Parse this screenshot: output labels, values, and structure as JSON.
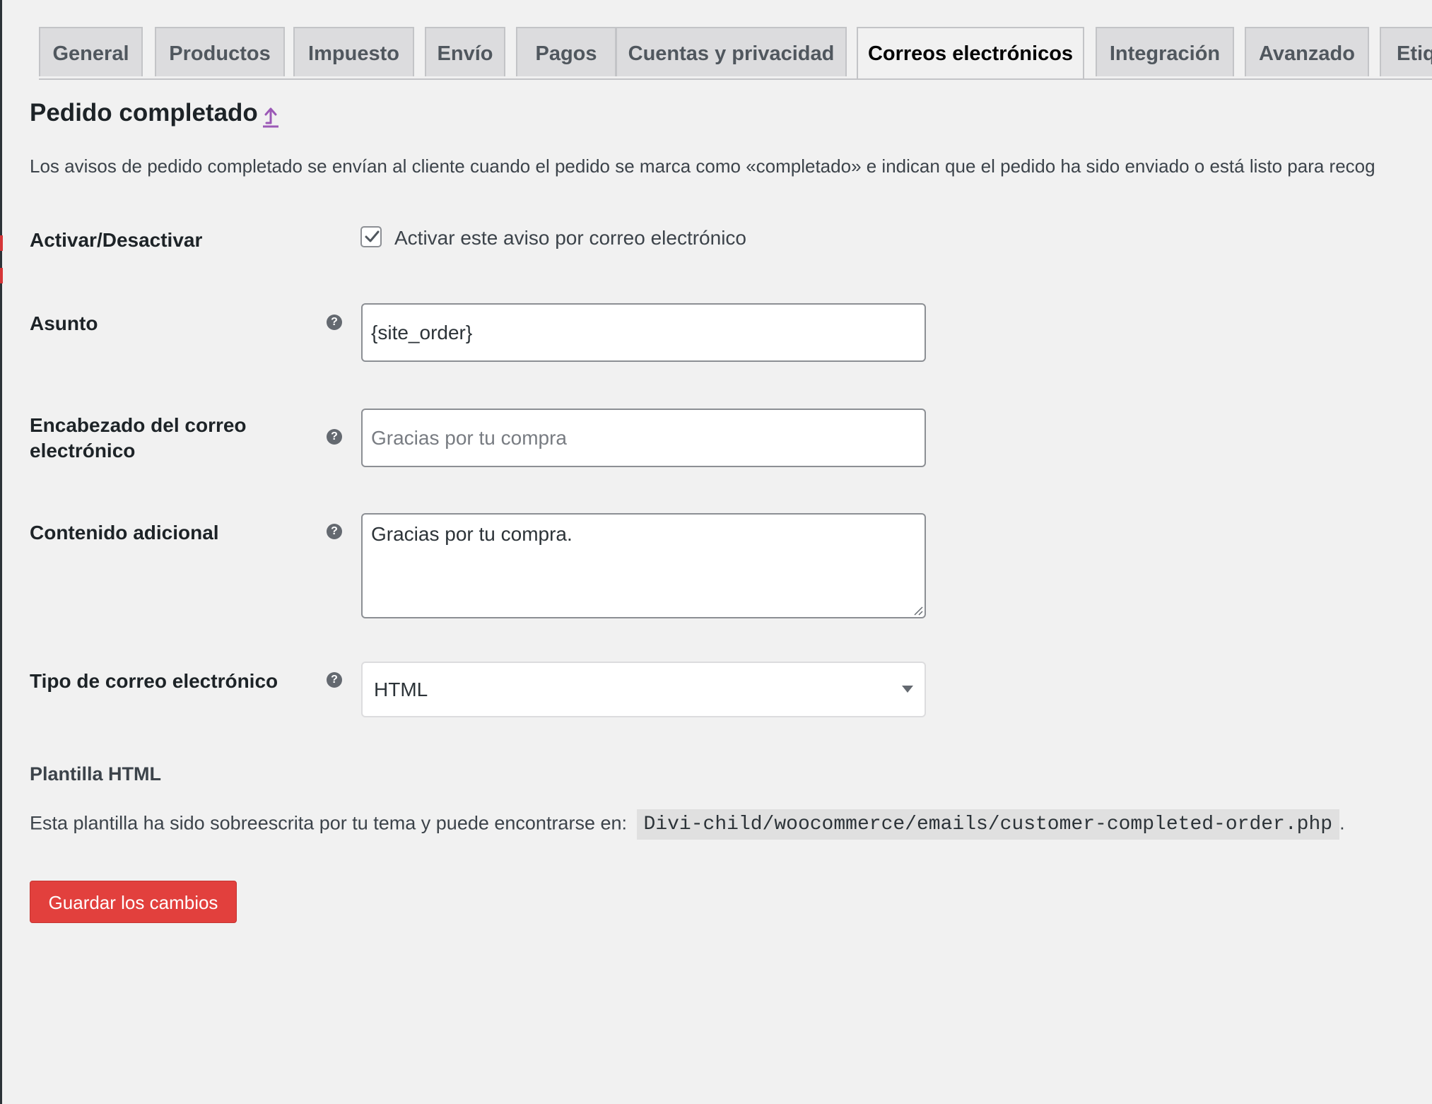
{
  "tabs": [
    {
      "label": "General",
      "active": false
    },
    {
      "label": "Productos",
      "active": false
    },
    {
      "label": "Impuesto",
      "active": false
    },
    {
      "label": "Envío",
      "active": false
    },
    {
      "label": "Pagos",
      "active": false
    },
    {
      "label": "Cuentas y privacidad",
      "active": false
    },
    {
      "label": "Correos electrónicos",
      "active": true
    },
    {
      "label": "Integración",
      "active": false
    },
    {
      "label": "Avanzado",
      "active": false
    },
    {
      "label": "Etiq",
      "active": false
    }
  ],
  "header": {
    "title": "Pedido completado",
    "up_icon": "arrow-up-icon"
  },
  "description": "Los avisos de pedido completado se envían al cliente cuando el pedido se marca como «completado» e indican que el pedido ha sido enviado o está listo para recog",
  "form": {
    "enable": {
      "label": "Activar/Desactivar",
      "checkbox_label": "Activar este aviso por correo electrónico",
      "checked": true
    },
    "subject": {
      "label": "Asunto",
      "value": "{site_order}",
      "placeholder": ""
    },
    "heading": {
      "label_line1": "Encabezado del correo",
      "label_line2": "electrónico",
      "value": "",
      "placeholder": "Gracias por tu compra"
    },
    "additional": {
      "label": "Contenido adicional",
      "value": "Gracias por tu compra."
    },
    "email_type": {
      "label": "Tipo de correo electrónico",
      "selected": "HTML"
    },
    "help_icon": "help-icon"
  },
  "template": {
    "heading": "Plantilla HTML",
    "text": "Esta plantilla ha sido sobreescrita por tu tema y puede encontrarse en:",
    "path": "Divi-child/woocommerce/emails/customer-completed-order.php",
    "suffix": "."
  },
  "save_label": "Guardar los cambios",
  "colors": {
    "background": "#f1f1f1",
    "save_button": "#e2403d",
    "accent_icon": "#9b59b6"
  }
}
